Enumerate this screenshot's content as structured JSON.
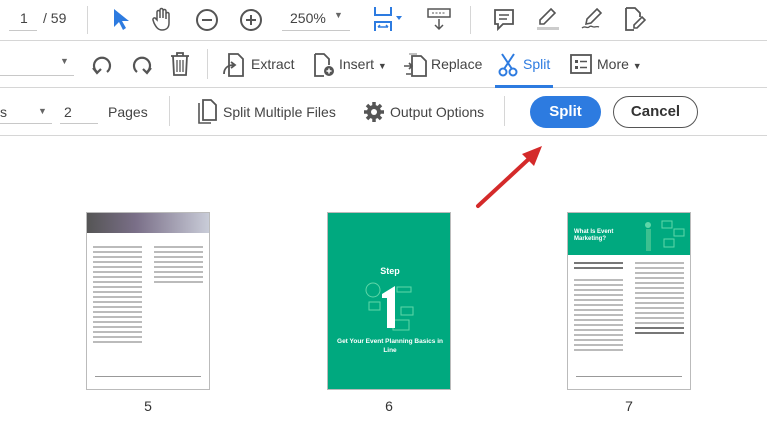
{
  "toolbar": {
    "page_current": "1",
    "page_total": "/ 59",
    "zoom": "250%"
  },
  "organize": {
    "extract": "Extract",
    "insert": "Insert",
    "replace": "Replace",
    "split": "Split",
    "more": "More"
  },
  "split_bar": {
    "by_partial": "s",
    "count": "2",
    "pages_label": "Pages",
    "split_multiple": "Split Multiple Files",
    "output_options": "Output Options",
    "split_button": "Split",
    "cancel_button": "Cancel"
  },
  "thumbnails": [
    {
      "page": "5"
    },
    {
      "page": "6",
      "step": "Step",
      "title": "Get Your Event Planning Basics in Line"
    },
    {
      "page": "7",
      "heading": "What Is Event Marketing?"
    }
  ],
  "colors": {
    "accent": "#2d7be0",
    "cover_green": "#00a97f",
    "arrow": "#d42a2a"
  }
}
